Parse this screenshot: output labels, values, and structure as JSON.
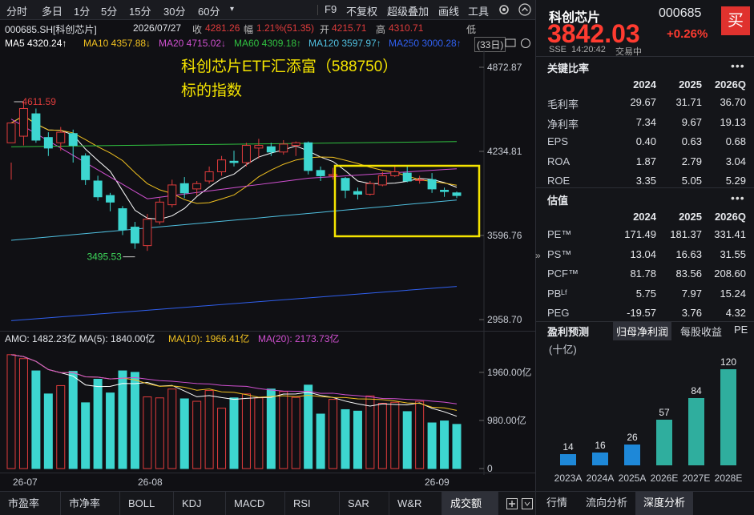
{
  "toolbar": {
    "periods": [
      "分时",
      "多日",
      "1分",
      "5分",
      "15分",
      "30分",
      "60分"
    ],
    "dropdown": "▾",
    "right_items": [
      "F9",
      "不复权",
      "超级叠加",
      "画线",
      "工具"
    ]
  },
  "info": {
    "code": "000685.SH[科创芯片]",
    "date": "2026/07/27",
    "close_label": "收",
    "close": "4281.26",
    "chg_label": "幅",
    "chg": "1.21%(51.35)",
    "open_label": "开",
    "open": "4215.71",
    "high_label": "高",
    "high": "4310.71",
    "low_label": "低"
  },
  "ma": {
    "ma5": "MA5 4320.24↑",
    "ma10": "MA10 4357.88↓",
    "ma20": "MA20 4715.02↓",
    "ma60": "MA60 4309.18↑",
    "ma120": "MA120 3597.97↑",
    "ma250": "MA250 3000.28↑",
    "count": "(33日)"
  },
  "colors": {
    "up": "#e03c3c",
    "down": "#3dd6d0",
    "ma5": "#ffffff",
    "ma10": "#f0c020",
    "ma20": "#d050d0",
    "ma60": "#30c040",
    "ma120": "#50c0e0",
    "ma250": "#3060f0",
    "highlight": "#f5e400",
    "price_red": "#ff3b30"
  },
  "chart_data": {
    "type": "candlestick",
    "y_ticks": [
      "4872.87",
      "4234.81",
      "3596.76",
      "2958.70"
    ],
    "ylim": [
      2958.7,
      4872.87
    ],
    "annotations": {
      "high": "4611.59",
      "low": "3495.53"
    },
    "overlay_title": "科创芯片ETF汇添富（588750）",
    "overlay_subtitle": "标的指数",
    "candles": [
      [
        4300,
        4450,
        4150,
        4020
      ],
      [
        4350,
        4560,
        4611.59,
        4280
      ],
      [
        4520,
        4320,
        4560,
        4300
      ],
      [
        4340,
        4260,
        4380,
        4200
      ],
      [
        4300,
        4380,
        4420,
        4240
      ],
      [
        4370,
        4280,
        4400,
        4150
      ],
      [
        4200,
        4020,
        4220,
        3980
      ],
      [
        4010,
        3890,
        4050,
        3860
      ],
      [
        3900,
        3850,
        3920,
        3780
      ],
      [
        3800,
        3640,
        3820,
        3600
      ],
      [
        3660,
        3540,
        3700,
        3495.53
      ],
      [
        3520,
        3720,
        3760,
        3480
      ],
      [
        3700,
        3850,
        3880,
        3680
      ],
      [
        3830,
        3980,
        4020,
        3810
      ],
      [
        3990,
        3920,
        4040,
        3880
      ],
      [
        3950,
        3990,
        4010,
        3900
      ],
      [
        4010,
        4080,
        4120,
        3990
      ],
      [
        4080,
        4170,
        4200,
        4050
      ],
      [
        4160,
        4150,
        4240,
        4120
      ],
      [
        4150,
        4280,
        4300,
        4120
      ],
      [
        4260,
        4280,
        4330,
        4180
      ],
      [
        4270,
        4230,
        4300,
        4200
      ],
      [
        4230,
        4290,
        4320,
        4210
      ],
      [
        4280,
        4300,
        4310,
        4200
      ],
      [
        4300,
        4090,
        4310,
        4060
      ],
      [
        4090,
        4050,
        4120,
        4010
      ],
      [
        4050,
        4060,
        4110,
        4020
      ],
      [
        4030,
        3940,
        4040,
        3880
      ],
      [
        3930,
        3910,
        3960,
        3870
      ],
      [
        3910,
        3990,
        4010,
        3900
      ],
      [
        3980,
        4050,
        4080,
        3970
      ],
      [
        4050,
        4080,
        4130,
        4040
      ],
      [
        4070,
        4010,
        4120,
        4000
      ],
      [
        4020,
        4020,
        4050,
        3990
      ],
      [
        4020,
        3950,
        4070,
        3920
      ],
      [
        3940,
        3930,
        3960,
        3890
      ],
      [
        3920,
        3900,
        3930,
        3880
      ]
    ],
    "volume": {
      "label": "AMO: 1482.23亿 MA(5): 1840.00亿",
      "ma10": "MA(10): 1966.41亿",
      "ma20": "MA(20): 2173.73亿",
      "y_ticks": [
        "1960.00亿",
        "980.00亿",
        "0"
      ],
      "ylim": [
        0,
        2350
      ],
      "values": [
        2320,
        2240,
        1990,
        1520,
        1690,
        1980,
        1340,
        1820,
        1540,
        1990,
        1960,
        1460,
        1440,
        1620,
        1420,
        1370,
        1590,
        1230,
        1440,
        1520,
        1440,
        1620,
        1570,
        1450,
        1700,
        1110,
        1410,
        1200,
        1170,
        1480,
        1330,
        1350,
        1160,
        1370,
        930,
        970,
        900
      ]
    },
    "x_labels": [
      "26-07",
      "26-08",
      "26-09"
    ]
  },
  "indicator_tabs": [
    "市盈率",
    "市净率",
    "BOLL",
    "KDJ",
    "MACD",
    "RSI",
    "SAR",
    "W&R",
    "成交额"
  ],
  "right": {
    "name": "科创芯片",
    "code": "000685",
    "price": "3842.03",
    "change": "+0.26%",
    "buy": "买",
    "exchange": "SSE",
    "time": "14:20:42",
    "status": "交易中",
    "section1": "关键比率",
    "years": [
      "2024",
      "2025",
      "2026Q"
    ],
    "ratios": [
      [
        "毛利率",
        "29.67",
        "31.71",
        "36.70"
      ],
      [
        "净利率",
        "7.34",
        "9.67",
        "19.13"
      ],
      [
        "EPS",
        "0.40",
        "0.63",
        "0.68"
      ],
      [
        "ROA",
        "1.87",
        "2.79",
        "3.04"
      ],
      [
        "ROE",
        "3.35",
        "5.05",
        "5.29"
      ]
    ],
    "section2": "估值",
    "valuation": [
      [
        "PE™",
        "171.49",
        "181.37",
        "331.41"
      ],
      [
        "PS™",
        "13.04",
        "16.63",
        "31.55"
      ],
      [
        "PCF™",
        "81.78",
        "83.56",
        "208.60"
      ],
      [
        "PBᴸᶠ",
        "5.75",
        "7.97",
        "15.24"
      ],
      [
        "PEG",
        "-19.57",
        "3.76",
        "4.32"
      ]
    ],
    "forecast_tabs": [
      "盈利预测",
      "归母净利润",
      "每股收益",
      "PE"
    ],
    "unit": "(十亿)",
    "forecast": {
      "labels": [
        "2023A",
        "2024A",
        "2025A",
        "2026E",
        "2027E",
        "2028E"
      ],
      "values": [
        14,
        16,
        26,
        57,
        84,
        120
      ]
    },
    "bottom_tabs": [
      "行情",
      "流向分析",
      "深度分析"
    ],
    "more": "•••"
  }
}
